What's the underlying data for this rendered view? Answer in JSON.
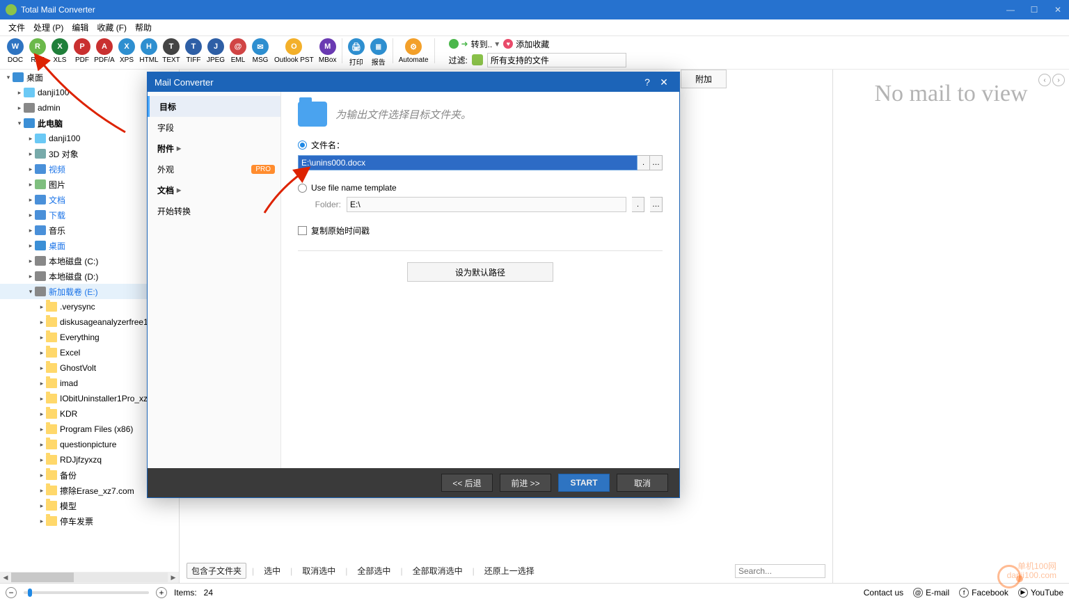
{
  "titlebar": {
    "app": "Total Mail Converter"
  },
  "menu": [
    "文件",
    "处理 (P)",
    "编辑",
    "收藏 (F)",
    "帮助"
  ],
  "toolbar": {
    "buttons": [
      {
        "label": "DOC",
        "color": "#2e74c2",
        "txt": "W"
      },
      {
        "label": "RTF",
        "color": "#6bb94a",
        "txt": "R"
      },
      {
        "label": "XLS",
        "color": "#1f7f3a",
        "txt": "X"
      },
      {
        "label": "PDF",
        "color": "#c93030",
        "txt": "P"
      },
      {
        "label": "PDF/A",
        "color": "#c93030",
        "txt": "A"
      },
      {
        "label": "XPS",
        "color": "#2e8fd0",
        "txt": "X"
      },
      {
        "label": "HTML",
        "color": "#2e8fd0",
        "txt": "H"
      },
      {
        "label": "TEXT",
        "color": "#444",
        "txt": "T"
      },
      {
        "label": "TIFF",
        "color": "#2e5fa6",
        "txt": "T"
      },
      {
        "label": "JPEG",
        "color": "#2e5fa6",
        "txt": "J"
      },
      {
        "label": "EML",
        "color": "#d14545",
        "txt": "@"
      },
      {
        "label": "MSG",
        "color": "#2e8fd0",
        "txt": "✉"
      },
      {
        "label": "Outlook PST",
        "color": "#f3b02a",
        "txt": "O",
        "wide": true
      },
      {
        "label": "MBox",
        "color": "#6a3ab2",
        "txt": "M"
      },
      {
        "label": "打印",
        "color": "#2e8fd0",
        "txt": "🖨"
      },
      {
        "label": "报告",
        "color": "#2e8fd0",
        "txt": "≣"
      },
      {
        "label": "Automate",
        "color": "#f3a02a",
        "txt": "⚙",
        "wide": true
      }
    ],
    "filter": {
      "goto": "转到..",
      "fav": "添加收藏",
      "label": "过滤:",
      "value": "所有支持的文件"
    }
  },
  "tree": {
    "root": "桌面",
    "items": [
      {
        "d": 0,
        "tw": "▾",
        "icon": "desktop",
        "label": "桌面"
      },
      {
        "d": 1,
        "tw": "▸",
        "icon": "folder-b",
        "label": "danji100"
      },
      {
        "d": 1,
        "tw": "▸",
        "icon": "user",
        "label": "admin"
      },
      {
        "d": 1,
        "tw": "▾",
        "icon": "pc",
        "label": "此电脑",
        "bold": true
      },
      {
        "d": 2,
        "tw": "▸",
        "icon": "folder-b",
        "label": "danji100"
      },
      {
        "d": 2,
        "tw": "▸",
        "icon": "cube",
        "label": "3D 对象"
      },
      {
        "d": 2,
        "tw": "▸",
        "icon": "video",
        "label": "视频",
        "blue": true
      },
      {
        "d": 2,
        "tw": "▸",
        "icon": "image",
        "label": "图片"
      },
      {
        "d": 2,
        "tw": "▸",
        "icon": "doc",
        "label": "文档",
        "blue": true
      },
      {
        "d": 2,
        "tw": "▸",
        "icon": "download",
        "label": "下载",
        "blue": true
      },
      {
        "d": 2,
        "tw": "▸",
        "icon": "music",
        "label": "音乐"
      },
      {
        "d": 2,
        "tw": "▸",
        "icon": "desktop",
        "label": "桌面",
        "blue": true
      },
      {
        "d": 2,
        "tw": "▸",
        "icon": "drive",
        "label": "本地磁盘 (C:)"
      },
      {
        "d": 2,
        "tw": "▸",
        "icon": "drive",
        "label": "本地磁盘 (D:)"
      },
      {
        "d": 2,
        "tw": "▾",
        "icon": "drive",
        "label": "新加载卷 (E:)",
        "blue": true,
        "sel": true
      },
      {
        "d": 3,
        "tw": "▸",
        "icon": "fy",
        "label": ".verysync"
      },
      {
        "d": 3,
        "tw": "▸",
        "icon": "fy",
        "label": "diskusageanalyzerfree1"
      },
      {
        "d": 3,
        "tw": "▸",
        "icon": "fy",
        "label": "Everything"
      },
      {
        "d": 3,
        "tw": "▸",
        "icon": "fy",
        "label": "Excel"
      },
      {
        "d": 3,
        "tw": "▸",
        "icon": "fy",
        "label": "GhostVolt"
      },
      {
        "d": 3,
        "tw": "▸",
        "icon": "fy",
        "label": "imad"
      },
      {
        "d": 3,
        "tw": "▸",
        "icon": "fy",
        "label": "IObitUninstaller1Pro_xz"
      },
      {
        "d": 3,
        "tw": "▸",
        "icon": "fy",
        "label": "KDR"
      },
      {
        "d": 3,
        "tw": "▸",
        "icon": "fy",
        "label": "Program Files (x86)"
      },
      {
        "d": 3,
        "tw": "▸",
        "icon": "fy",
        "label": "questionpicture"
      },
      {
        "d": 3,
        "tw": "▸",
        "icon": "fy",
        "label": "RDJjfzyxzq"
      },
      {
        "d": 3,
        "tw": "▸",
        "icon": "fy",
        "label": "备份"
      },
      {
        "d": 3,
        "tw": "▸",
        "icon": "fy",
        "label": "擦除Erase_xz7.com"
      },
      {
        "d": 3,
        "tw": "▸",
        "icon": "fy",
        "label": "模型"
      },
      {
        "d": 3,
        "tw": "▸",
        "icon": "fy",
        "label": "停车发票"
      }
    ]
  },
  "center": {
    "tab": "附加",
    "actions": [
      "包含子文件夹",
      "选中",
      "取消选中",
      "全部选中",
      "全部取消选中",
      "还原上一选择"
    ],
    "search_placeholder": "Search..."
  },
  "right": {
    "msg": "No mail to view"
  },
  "status": {
    "items_label": "Items:",
    "items": "24",
    "contact": "Contact us",
    "email": "E-mail",
    "facebook": "Facebook",
    "youtube": "YouTube"
  },
  "dialog": {
    "title": "Mail Converter",
    "side": [
      {
        "label": "目标",
        "sel": true
      },
      {
        "label": "字段"
      },
      {
        "label": "附件",
        "chev": true,
        "bold": true
      },
      {
        "label": "外观",
        "pro": "PRO"
      },
      {
        "label": "文档",
        "chev": true,
        "bold": true
      },
      {
        "label": "开始转换"
      }
    ],
    "head": "为输出文件选择目标文件夹。",
    "radio_filename": "文件名：",
    "filename_value": "E:\\unins000.docx",
    "radio_template": "Use file name template",
    "folder_label": "Folder:",
    "folder_value": "E:\\",
    "chk_label": "复制原始时间戳",
    "default_btn": "设为默认路径",
    "foot": {
      "back": "<< 后退",
      "next": "前进 >>",
      "start": "START",
      "cancel": "取消"
    }
  },
  "watermark": {
    "l1": "单机100网",
    "l2": "danji100.com"
  }
}
